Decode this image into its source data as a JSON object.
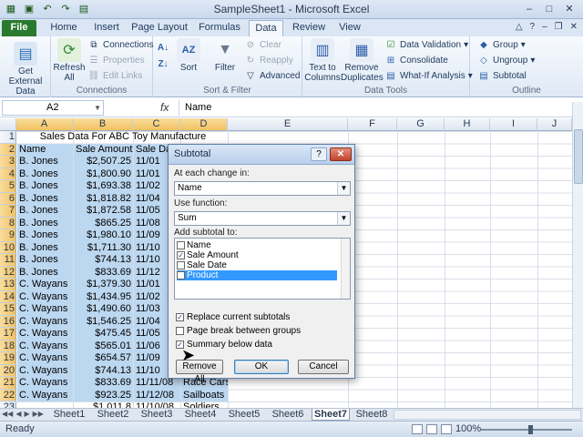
{
  "window": {
    "title": "SampleSheet1 - Microsoft Excel"
  },
  "tabs": [
    {
      "label": "File"
    },
    {
      "label": "Home"
    },
    {
      "label": "Insert"
    },
    {
      "label": "Page Layout"
    },
    {
      "label": "Formulas"
    },
    {
      "label": "Data"
    },
    {
      "label": "Review"
    },
    {
      "label": "View"
    }
  ],
  "ribbon": {
    "get_external_data": "Get External Data",
    "refresh_all": "Refresh All",
    "connections": "Connections",
    "properties": "Properties",
    "edit_links": "Edit Links",
    "group_connections": "Connections",
    "sort": "Sort",
    "filter": "Filter",
    "clear": "Clear",
    "reapply": "Reapply",
    "advanced": "Advanced",
    "group_sort_filter": "Sort & Filter",
    "text_to_columns": "Text to Columns",
    "remove_duplicates": "Remove Duplicates",
    "data_validation": "Data Validation",
    "consolidate": "Consolidate",
    "what_if": "What-If Analysis",
    "group_data_tools": "Data Tools",
    "group": "Group",
    "ungroup": "Ungroup",
    "subtotal": "Subtotal",
    "group_outline": "Outline"
  },
  "formula_bar": {
    "name_box": "A2",
    "fx": "fx",
    "content": "Name"
  },
  "columns": [
    "A",
    "B",
    "C",
    "D",
    "E",
    "F",
    "G",
    "H",
    "I",
    "J"
  ],
  "sheet": {
    "title": "Sales Data For ABC Toy Manufacture",
    "headers": [
      "Name",
      "Sale Amount",
      "Sale Da"
    ],
    "rows": [
      {
        "n": "2",
        "a": "Name",
        "b": "Sale Amount",
        "c": "Sale Da",
        "d": ""
      },
      {
        "n": "3",
        "a": "B. Jones",
        "b": "$2,507.25",
        "c": "11/01",
        "d": ""
      },
      {
        "n": "4",
        "a": "B. Jones",
        "b": "$1,800.90",
        "c": "11/01",
        "d": ""
      },
      {
        "n": "5",
        "a": "B. Jones",
        "b": "$1,693.38",
        "c": "11/02",
        "d": ""
      },
      {
        "n": "6",
        "a": "B. Jones",
        "b": "$1,818.82",
        "c": "11/04",
        "d": ""
      },
      {
        "n": "7",
        "a": "B. Jones",
        "b": "$1,872.58",
        "c": "11/05",
        "d": ""
      },
      {
        "n": "8",
        "a": "B. Jones",
        "b": "$865.25",
        "c": "11/08",
        "d": ""
      },
      {
        "n": "9",
        "a": "B. Jones",
        "b": "$1,980.10",
        "c": "11/09",
        "d": ""
      },
      {
        "n": "10",
        "a": "B. Jones",
        "b": "$1,711.30",
        "c": "11/10",
        "d": ""
      },
      {
        "n": "11",
        "a": "B. Jones",
        "b": "$744.13",
        "c": "11/10",
        "d": ""
      },
      {
        "n": "12",
        "a": "B. Jones",
        "b": "$833.69",
        "c": "11/12",
        "d": ""
      },
      {
        "n": "13",
        "a": "C. Wayans",
        "b": "$1,379.30",
        "c": "11/01",
        "d": ""
      },
      {
        "n": "14",
        "a": "C. Wayans",
        "b": "$1,434.95",
        "c": "11/02",
        "d": ""
      },
      {
        "n": "15",
        "a": "C. Wayans",
        "b": "$1,490.60",
        "c": "11/03",
        "d": ""
      },
      {
        "n": "16",
        "a": "C. Wayans",
        "b": "$1,546.25",
        "c": "11/04",
        "d": ""
      },
      {
        "n": "17",
        "a": "C. Wayans",
        "b": "$475.45",
        "c": "11/05",
        "d": ""
      },
      {
        "n": "18",
        "a": "C. Wayans",
        "b": "$565.01",
        "c": "11/06",
        "d": ""
      },
      {
        "n": "19",
        "a": "C. Wayans",
        "b": "$654.57",
        "c": "11/09",
        "d": ""
      },
      {
        "n": "20",
        "a": "C. Wayans",
        "b": "$744.13",
        "c": "11/10",
        "d": ""
      },
      {
        "n": "21",
        "a": "C. Wayans",
        "b": "$833.69",
        "c": "11/11/08",
        "d": "Race Cars"
      },
      {
        "n": "22",
        "a": "C. Wayans",
        "b": "$923.25",
        "c": "11/12/08",
        "d": "Sailboats"
      },
      {
        "n": "23",
        "a": "",
        "b": "$1,011.8",
        "c": "11/10/08",
        "d": "Soldiers"
      }
    ]
  },
  "dialog": {
    "title": "Subtotal",
    "help": "?",
    "close": "✕",
    "at_each_change_label": "At each change in:",
    "at_each_change_value": "Name",
    "use_function_label": "Use function:",
    "use_function_value": "Sum",
    "add_subtotal_label": "Add subtotal to:",
    "list": [
      {
        "label": "Name",
        "checked": false
      },
      {
        "label": "Sale Amount",
        "checked": true
      },
      {
        "label": "Sale Date",
        "checked": false
      },
      {
        "label": "Product",
        "checked": false
      }
    ],
    "replace_current": "Replace current subtotals",
    "page_break": "Page break between groups",
    "summary_below": "Summary below data",
    "remove_all": "Remove All",
    "ok": "OK",
    "cancel": "Cancel"
  },
  "sheets": [
    "Sheet1",
    "Sheet2",
    "Sheet3",
    "Sheet4",
    "Sheet5",
    "Sheet6",
    "Sheet7",
    "Sheet8"
  ],
  "status": {
    "ready": "Ready",
    "zoom": "100%"
  }
}
